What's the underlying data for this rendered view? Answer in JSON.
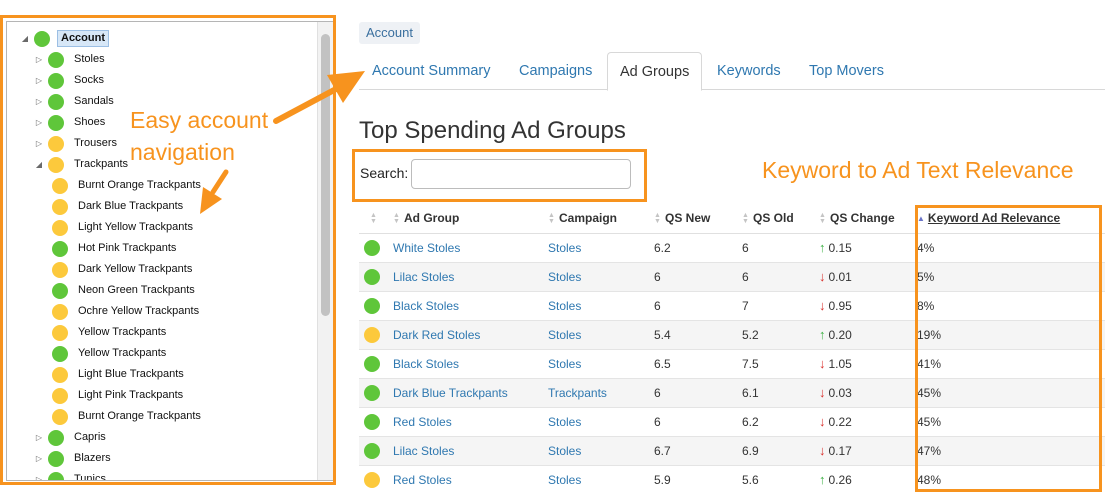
{
  "tree": {
    "items": [
      {
        "label": "Account",
        "level": 0,
        "toggle": "expanded",
        "status": "green",
        "selected": true
      },
      {
        "label": "Stoles",
        "level": 1,
        "toggle": "collapsed",
        "status": "green"
      },
      {
        "label": "Socks",
        "level": 1,
        "toggle": "collapsed",
        "status": "green"
      },
      {
        "label": "Sandals",
        "level": 1,
        "toggle": "collapsed",
        "status": "green"
      },
      {
        "label": "Shoes",
        "level": 1,
        "toggle": "collapsed",
        "status": "green"
      },
      {
        "label": "Trousers",
        "level": 1,
        "toggle": "collapsed",
        "status": "yellow"
      },
      {
        "label": "Trackpants",
        "level": 1,
        "toggle": "expanded",
        "status": "yellow"
      },
      {
        "label": "Burnt Orange Trackpants",
        "level": 2,
        "toggle": "none",
        "status": "yellow"
      },
      {
        "label": "Dark Blue Trackpants",
        "level": 2,
        "toggle": "none",
        "status": "yellow"
      },
      {
        "label": "Light Yellow Trackpants",
        "level": 2,
        "toggle": "none",
        "status": "yellow"
      },
      {
        "label": "Hot Pink Trackpants",
        "level": 2,
        "toggle": "none",
        "status": "green"
      },
      {
        "label": "Dark Yellow Trackpants",
        "level": 2,
        "toggle": "none",
        "status": "yellow"
      },
      {
        "label": "Neon Green Trackpants",
        "level": 2,
        "toggle": "none",
        "status": "green"
      },
      {
        "label": "Ochre Yellow Trackpants",
        "level": 2,
        "toggle": "none",
        "status": "yellow"
      },
      {
        "label": "Yellow Trackpants",
        "level": 2,
        "toggle": "none",
        "status": "yellow"
      },
      {
        "label": "Yellow Trackpants",
        "level": 2,
        "toggle": "none",
        "status": "green"
      },
      {
        "label": "Light Blue Trackpants",
        "level": 2,
        "toggle": "none",
        "status": "yellow"
      },
      {
        "label": "Light Pink Trackpants",
        "level": 2,
        "toggle": "none",
        "status": "yellow"
      },
      {
        "label": "Burnt Orange Trackpants",
        "level": 2,
        "toggle": "none",
        "status": "yellow"
      },
      {
        "label": "Capris",
        "level": 1,
        "toggle": "collapsed",
        "status": "green"
      },
      {
        "label": "Blazers",
        "level": 1,
        "toggle": "collapsed",
        "status": "green"
      },
      {
        "label": "Tunics",
        "level": 1,
        "toggle": "collapsed",
        "status": "green"
      }
    ]
  },
  "annotations": {
    "nav_line1": "Easy account",
    "nav_line2": "navigation",
    "relevance": "Keyword to Ad Text Relevance"
  },
  "breadcrumb": "Account",
  "tabs": [
    {
      "label": "Account Summary",
      "active": false
    },
    {
      "label": "Campaigns",
      "active": false
    },
    {
      "label": "Ad Groups",
      "active": true
    },
    {
      "label": "Keywords",
      "active": false
    },
    {
      "label": "Top Movers",
      "active": false
    }
  ],
  "page_title": "Top Spending Ad Groups",
  "search": {
    "label": "Search:",
    "value": "",
    "placeholder": ""
  },
  "table": {
    "headers": {
      "ad_group": "Ad Group",
      "campaign": "Campaign",
      "qs_new": "QS New",
      "qs_old": "QS Old",
      "qs_change": "QS Change",
      "relevance": "Keyword Ad Relevance"
    },
    "rows": [
      {
        "status": "green",
        "ad_group": "White Stoles",
        "campaign": "Stoles",
        "qs_new": "6.2",
        "qs_old": "6",
        "direction": "up",
        "qs_change": "0.15",
        "relevance": "4%"
      },
      {
        "status": "green",
        "ad_group": "Lilac Stoles",
        "campaign": "Stoles",
        "qs_new": "6",
        "qs_old": "6",
        "direction": "down",
        "qs_change": "0.01",
        "relevance": "5%"
      },
      {
        "status": "green",
        "ad_group": "Black Stoles",
        "campaign": "Stoles",
        "qs_new": "6",
        "qs_old": "7",
        "direction": "down",
        "qs_change": "0.95",
        "relevance": "8%"
      },
      {
        "status": "yellow",
        "ad_group": "Dark Red Stoles",
        "campaign": "Stoles",
        "qs_new": "5.4",
        "qs_old": "5.2",
        "direction": "up",
        "qs_change": "0.20",
        "relevance": "19%"
      },
      {
        "status": "green",
        "ad_group": "Black Stoles",
        "campaign": "Stoles",
        "qs_new": "6.5",
        "qs_old": "7.5",
        "direction": "down",
        "qs_change": "1.05",
        "relevance": "41%"
      },
      {
        "status": "green",
        "ad_group": "Dark Blue Trackpants",
        "campaign": "Trackpants",
        "qs_new": "6",
        "qs_old": "6.1",
        "direction": "down",
        "qs_change": "0.03",
        "relevance": "45%"
      },
      {
        "status": "green",
        "ad_group": "Red Stoles",
        "campaign": "Stoles",
        "qs_new": "6",
        "qs_old": "6.2",
        "direction": "down",
        "qs_change": "0.22",
        "relevance": "45%"
      },
      {
        "status": "green",
        "ad_group": "Lilac Stoles",
        "campaign": "Stoles",
        "qs_new": "6.7",
        "qs_old": "6.9",
        "direction": "down",
        "qs_change": "0.17",
        "relevance": "47%"
      },
      {
        "status": "yellow",
        "ad_group": "Red Stoles",
        "campaign": "Stoles",
        "qs_new": "5.9",
        "qs_old": "5.6",
        "direction": "up",
        "qs_change": "0.26",
        "relevance": "48%"
      }
    ]
  },
  "colors": {
    "green": "#5fc63a",
    "yellow": "#fcc93c",
    "annotation": "#f7931e",
    "link": "#2f78b0"
  },
  "icons": {
    "expand": "triangle-right-icon",
    "collapse": "triangle-down-icon",
    "up": "arrow-up-icon",
    "down": "arrow-down-icon"
  }
}
